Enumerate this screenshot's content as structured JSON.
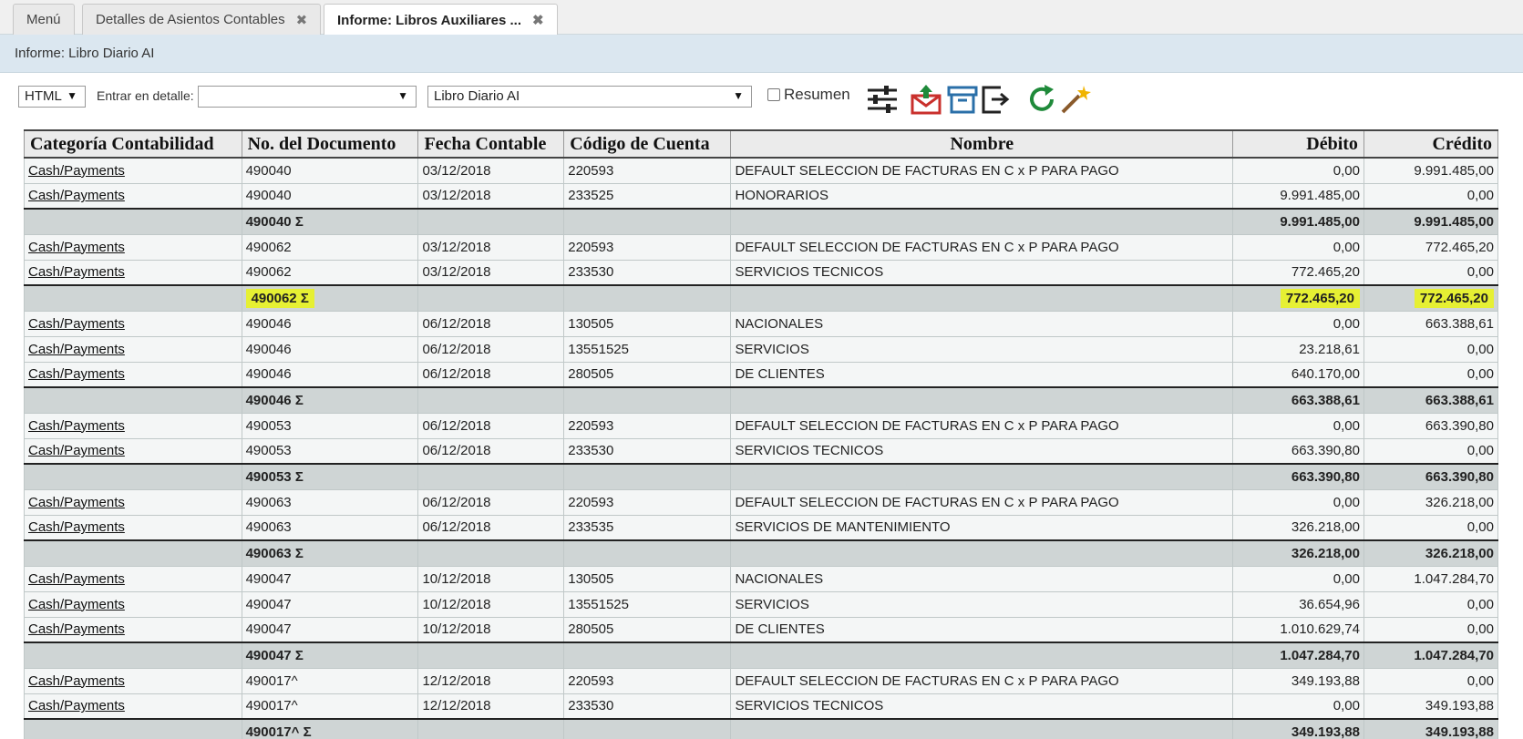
{
  "tabs": [
    {
      "label": "Menú",
      "closable": false,
      "active": false
    },
    {
      "label": "Detalles de Asientos Contables",
      "closable": true,
      "active": false
    },
    {
      "label": "Informe: Libros Auxiliares ...",
      "closable": true,
      "active": true
    }
  ],
  "close_glyph": "✖",
  "title": "Informe: Libro Diario AI",
  "toolbar": {
    "format_value": "HTML",
    "detail_label": "Entrar en detalle:",
    "detail_value": "",
    "report_value": "Libro Diario AI",
    "summary_label": "Resumen",
    "caret": "▼",
    "icons": [
      "settings-sliders-icon",
      "export-mail-icon",
      "archive-icon",
      "exit-icon",
      "refresh-icon",
      "wizard-wand-icon"
    ]
  },
  "colors": {
    "highlight": "#e6f033",
    "refresh": "#1f8a3a",
    "export": "#c9302c",
    "archive": "#2a6fa8"
  },
  "table": {
    "headers": [
      "Categoría Contabilidad",
      "No. del Documento",
      "Fecha Contable",
      "Código de Cuenta",
      "Nombre",
      "Débito",
      "Crédito"
    ],
    "rows": [
      {
        "type": "row",
        "cells": [
          "Cash/Payments",
          "490040",
          "03/12/2018",
          "220593",
          "DEFAULT SELECCION DE FACTURAS EN C x P PARA PAGO",
          "0,00",
          "9.991.485,00"
        ]
      },
      {
        "type": "row",
        "cells": [
          "Cash/Payments",
          "490040",
          "03/12/2018",
          "233525",
          "HONORARIOS",
          "9.991.485,00",
          "0,00"
        ]
      },
      {
        "type": "sum",
        "cells": [
          "",
          "490040 Σ",
          "",
          "",
          "",
          "9.991.485,00",
          "9.991.485,00"
        ]
      },
      {
        "type": "row",
        "cells": [
          "Cash/Payments",
          "490062",
          "03/12/2018",
          "220593",
          "DEFAULT SELECCION DE FACTURAS EN C x P PARA PAGO",
          "0,00",
          "772.465,20"
        ]
      },
      {
        "type": "row",
        "cells": [
          "Cash/Payments",
          "490062",
          "03/12/2018",
          "233530",
          "SERVICIOS TECNICOS",
          "772.465,20",
          "0,00"
        ]
      },
      {
        "type": "sum",
        "highlight": true,
        "cells": [
          "",
          "490062 Σ",
          "",
          "",
          "",
          "772.465,20",
          "772.465,20"
        ]
      },
      {
        "type": "row",
        "cells": [
          "Cash/Payments",
          "490046",
          "06/12/2018",
          "130505",
          "NACIONALES",
          "0,00",
          "663.388,61"
        ]
      },
      {
        "type": "row",
        "cells": [
          "Cash/Payments",
          "490046",
          "06/12/2018",
          "13551525",
          "SERVICIOS",
          "23.218,61",
          "0,00"
        ]
      },
      {
        "type": "row",
        "cells": [
          "Cash/Payments",
          "490046",
          "06/12/2018",
          "280505",
          "DE CLIENTES",
          "640.170,00",
          "0,00"
        ]
      },
      {
        "type": "sum",
        "cells": [
          "",
          "490046 Σ",
          "",
          "",
          "",
          "663.388,61",
          "663.388,61"
        ]
      },
      {
        "type": "row",
        "cells": [
          "Cash/Payments",
          "490053",
          "06/12/2018",
          "220593",
          "DEFAULT SELECCION DE FACTURAS EN C x P PARA PAGO",
          "0,00",
          "663.390,80"
        ]
      },
      {
        "type": "row",
        "cells": [
          "Cash/Payments",
          "490053",
          "06/12/2018",
          "233530",
          "SERVICIOS TECNICOS",
          "663.390,80",
          "0,00"
        ]
      },
      {
        "type": "sum",
        "cells": [
          "",
          "490053 Σ",
          "",
          "",
          "",
          "663.390,80",
          "663.390,80"
        ]
      },
      {
        "type": "row",
        "cells": [
          "Cash/Payments",
          "490063",
          "06/12/2018",
          "220593",
          "DEFAULT SELECCION DE FACTURAS EN C x P PARA PAGO",
          "0,00",
          "326.218,00"
        ]
      },
      {
        "type": "row",
        "cells": [
          "Cash/Payments",
          "490063",
          "06/12/2018",
          "233535",
          "SERVICIOS DE MANTENIMIENTO",
          "326.218,00",
          "0,00"
        ]
      },
      {
        "type": "sum",
        "cells": [
          "",
          "490063 Σ",
          "",
          "",
          "",
          "326.218,00",
          "326.218,00"
        ]
      },
      {
        "type": "row",
        "cells": [
          "Cash/Payments",
          "490047",
          "10/12/2018",
          "130505",
          "NACIONALES",
          "0,00",
          "1.047.284,70"
        ]
      },
      {
        "type": "row",
        "cells": [
          "Cash/Payments",
          "490047",
          "10/12/2018",
          "13551525",
          "SERVICIOS",
          "36.654,96",
          "0,00"
        ]
      },
      {
        "type": "row",
        "cells": [
          "Cash/Payments",
          "490047",
          "10/12/2018",
          "280505",
          "DE CLIENTES",
          "1.010.629,74",
          "0,00"
        ]
      },
      {
        "type": "sum",
        "cells": [
          "",
          "490047 Σ",
          "",
          "",
          "",
          "1.047.284,70",
          "1.047.284,70"
        ]
      },
      {
        "type": "row",
        "cells": [
          "Cash/Payments",
          "490017^",
          "12/12/2018",
          "220593",
          "DEFAULT SELECCION DE FACTURAS EN C x P PARA PAGO",
          "349.193,88",
          "0,00"
        ]
      },
      {
        "type": "row",
        "cells": [
          "Cash/Payments",
          "490017^",
          "12/12/2018",
          "233530",
          "SERVICIOS TECNICOS",
          "0,00",
          "349.193,88"
        ]
      },
      {
        "type": "sum",
        "cells": [
          "",
          "490017^ Σ",
          "",
          "",
          "",
          "349.193,88",
          "349.193,88"
        ]
      }
    ]
  }
}
